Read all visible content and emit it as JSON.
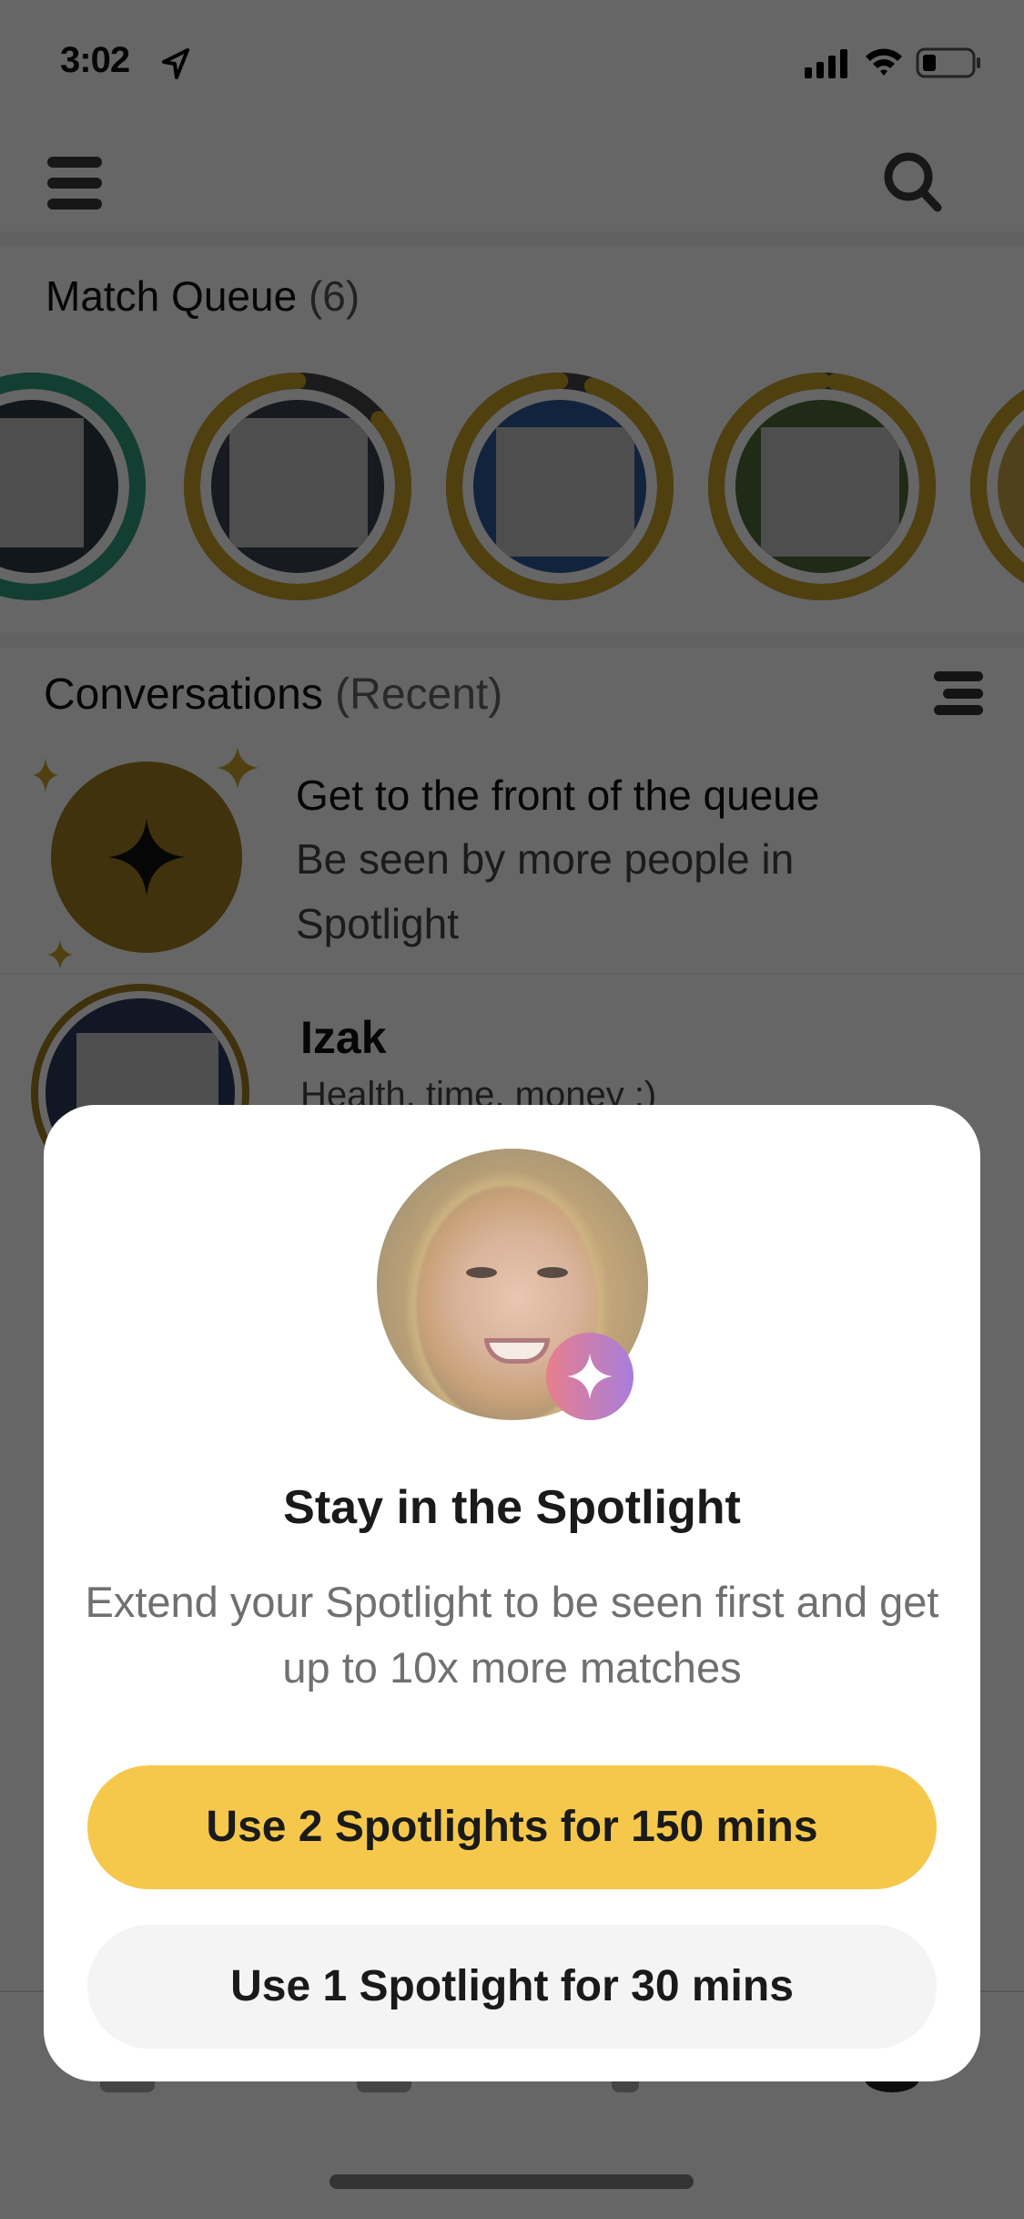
{
  "status_bar": {
    "time": "3:02",
    "icons": [
      "location-arrow-icon",
      "cellular-signal-icon",
      "wifi-icon",
      "battery-icon"
    ],
    "battery_level": 0.25
  },
  "header": {
    "menu_icon": "hamburger-menu-icon",
    "search_icon": "search-icon"
  },
  "match_queue": {
    "title": "Match Queue",
    "count": "(6)",
    "items": [
      {
        "ring_color": "#2f9e7c",
        "ring_progress": 1.0
      },
      {
        "ring_color": "#c9a12a",
        "ring_progress": 0.86
      },
      {
        "ring_color": "#c9a12a",
        "ring_progress": 0.95
      },
      {
        "ring_color": "#c9a12a",
        "ring_progress": 0.98
      },
      {
        "ring_color": "#c9a12a",
        "ring_progress": 1.0
      }
    ]
  },
  "conversations": {
    "title": "Conversations",
    "subtitle": "(Recent)",
    "sort_icon": "sort-lines-icon",
    "promo": {
      "icon": "spotlight-sparkle-icon",
      "title": "Get to the front of the queue",
      "subtitle": "Be seen by more people in Spotlight"
    },
    "items": [
      {
        "name": "Izak",
        "preview": "Health, time, money :)"
      }
    ]
  },
  "modal": {
    "badge_icon": "spotlight-sparkle-icon",
    "title": "Stay in the Spotlight",
    "body": "Extend your Spotlight to be seen first and get up to 10x more matches",
    "primary_button": "Use 2 Spotlights for 150 mins",
    "secondary_button": "Use 1 Spotlight for 30 mins"
  },
  "colors": {
    "accent_yellow": "#f5c84c",
    "gold": "#c9a12a",
    "teal": "#2f9e7c",
    "badge_gradient_start": "#e67f8c",
    "badge_gradient_end": "#a97ddb"
  }
}
